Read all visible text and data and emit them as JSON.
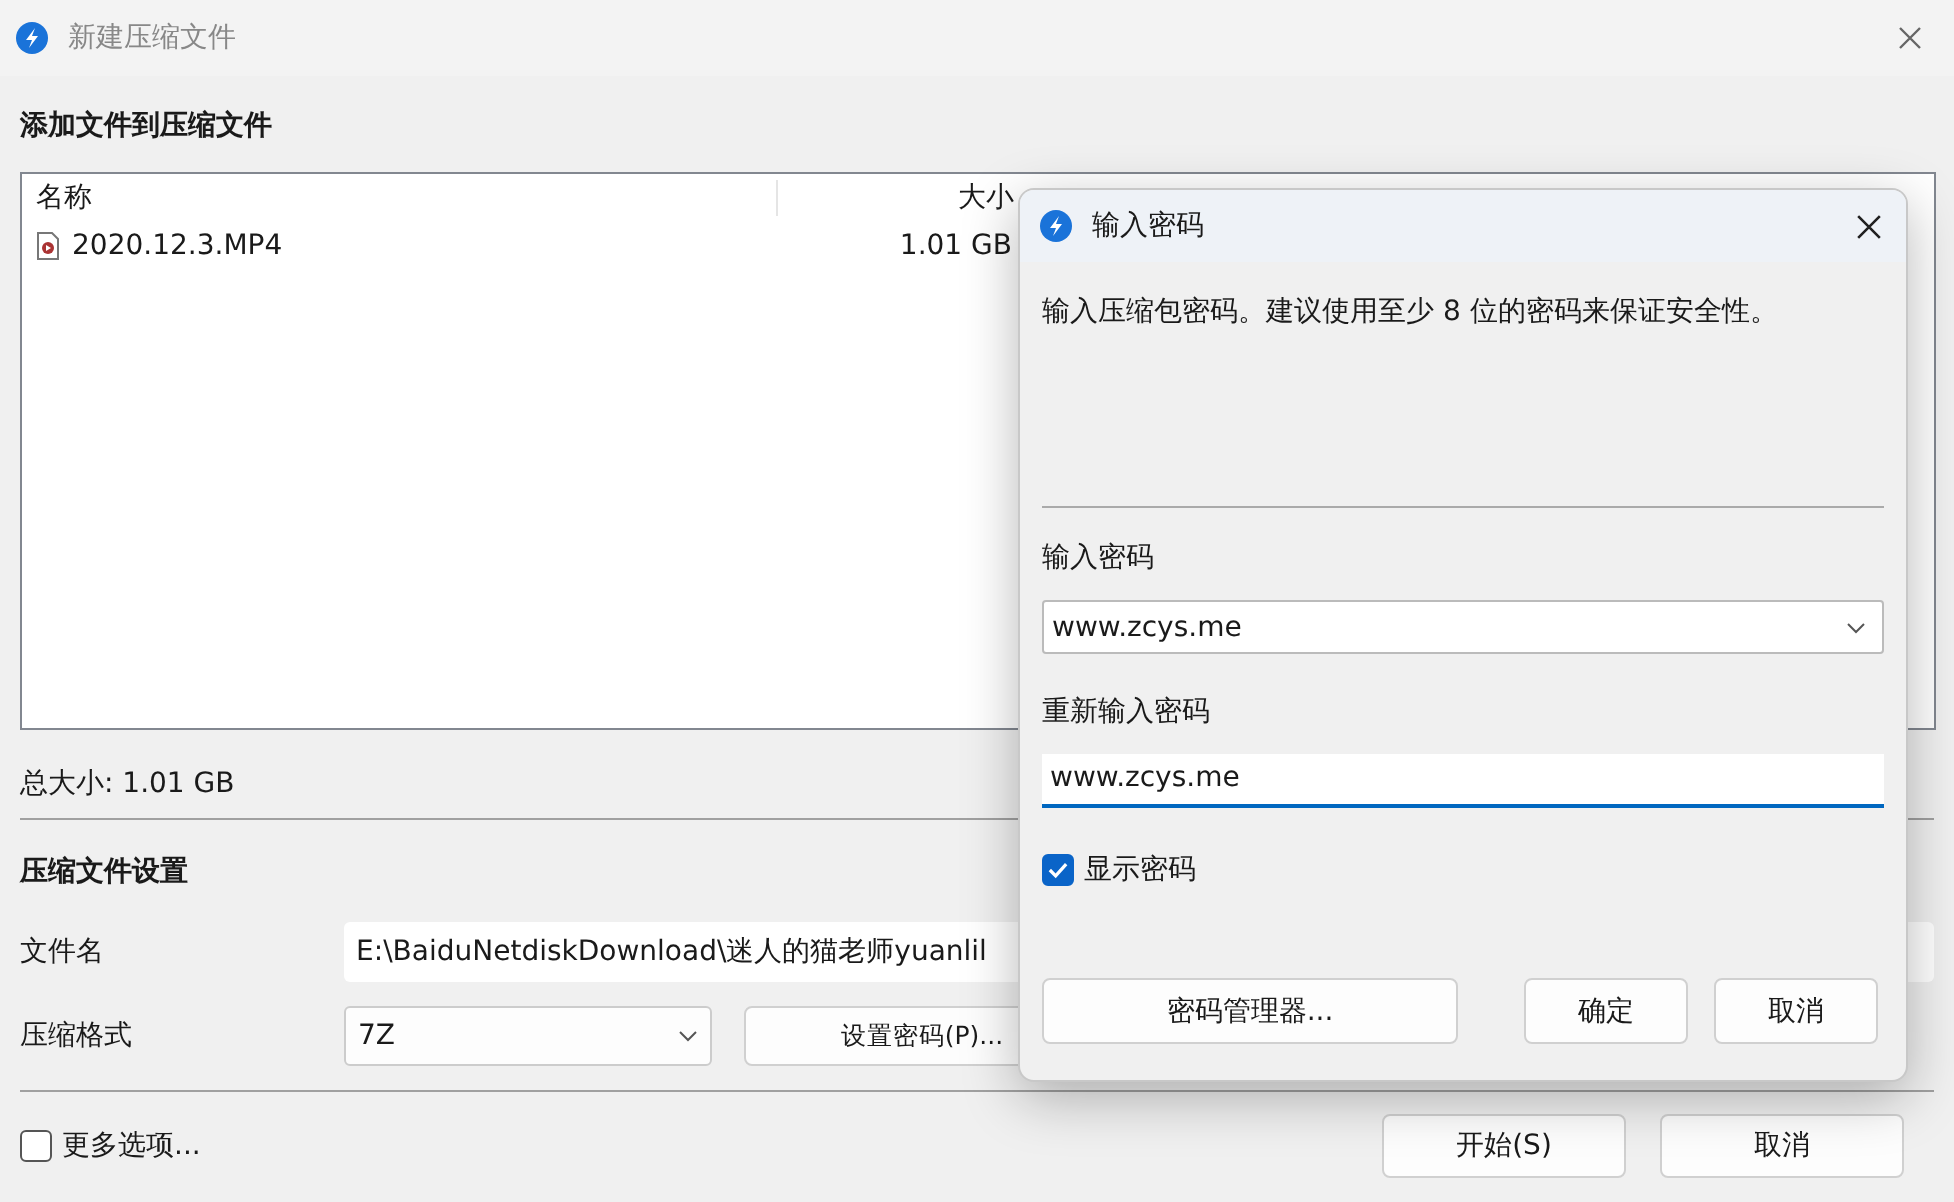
{
  "window": {
    "title": "新建压缩文件"
  },
  "add_section": {
    "heading": "添加文件到压缩文件"
  },
  "file_list": {
    "columns": [
      "名称",
      "大小"
    ],
    "rows": [
      {
        "name": "2020.12.3.MP4",
        "size": "1.01 GB"
      }
    ]
  },
  "total_size": "总大小: 1.01 GB",
  "settings": {
    "heading": "压缩文件设置",
    "filename_label": "文件名",
    "filename_value": "E:\\BaiduNetdiskDownload\\迷人的猫老师yuanlil",
    "format_label": "压缩格式",
    "format_value": "7Z",
    "set_password_button": "设置密码(P)..."
  },
  "more_options": {
    "label": "更多选项...",
    "checked": false
  },
  "buttons": [
    "开始(S)",
    "取消"
  ],
  "dialog": {
    "title": "输入密码",
    "message": "输入压缩包密码。建议使用至少 8 位的密码来保证安全性。",
    "password_label": "输入密码",
    "password_value": "www.zcys.me",
    "confirm_label": "重新输入密码",
    "confirm_value": "www.zcys.me",
    "show_password": {
      "label": "显示密码",
      "checked": true
    },
    "manager_button": "密码管理器...",
    "buttons": [
      "确定",
      "取消"
    ]
  }
}
